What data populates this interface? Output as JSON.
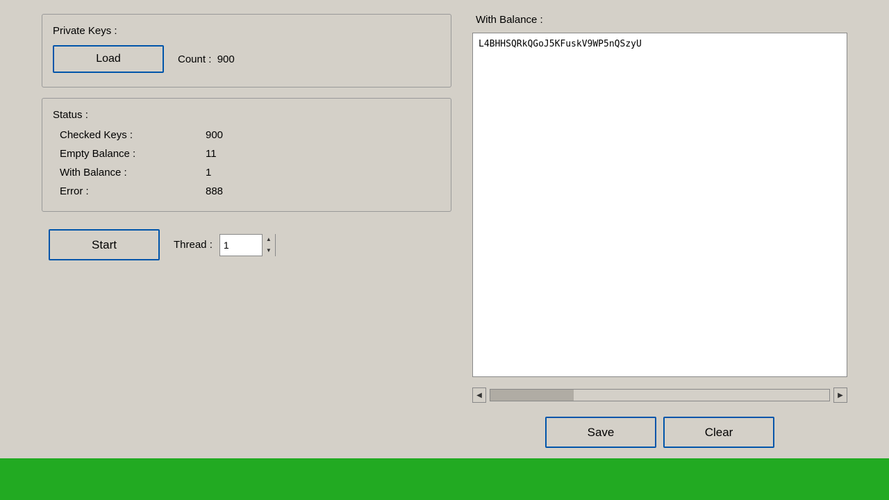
{
  "private_keys_section": {
    "title": "Private Keys :",
    "load_button_label": "Load",
    "count_label": "Count :",
    "count_value": "900"
  },
  "status_section": {
    "title": "Status :",
    "rows": [
      {
        "label": "Checked Keys :",
        "value": "900"
      },
      {
        "label": "Empty Balance :",
        "value": "11"
      },
      {
        "label": "With Balance :",
        "value": "1"
      },
      {
        "label": "Error :",
        "value": "888"
      }
    ]
  },
  "controls": {
    "start_label": "Start",
    "thread_label": "Thread :",
    "thread_value": "1"
  },
  "right_panel": {
    "title": "With Balance :",
    "text_content": "L4BHHSQRkQGoJ5KFuskV9WP5nQSzyU"
  },
  "action_buttons": {
    "save_label": "Save",
    "clear_label": "Clear"
  }
}
